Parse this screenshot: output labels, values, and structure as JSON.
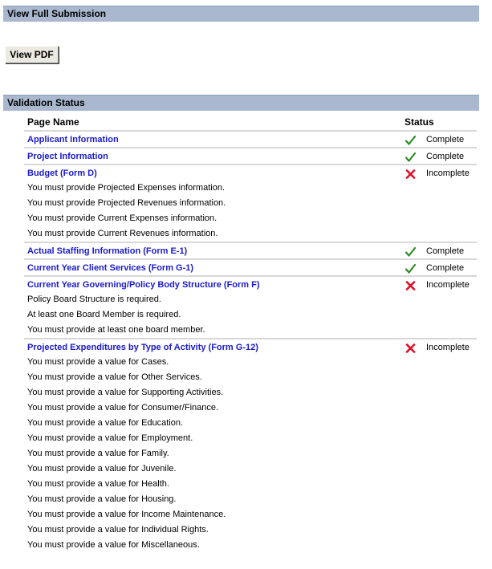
{
  "section1": {
    "title": "View Full Submission"
  },
  "pdf_button": {
    "label": "View PDF"
  },
  "section2": {
    "title": "Validation Status"
  },
  "table": {
    "col_page": "Page Name",
    "col_status": "Status",
    "entries": [
      {
        "name": "Applicant Information",
        "status": "Complete",
        "ok": true,
        "messages": []
      },
      {
        "name": "Project Information",
        "status": "Complete",
        "ok": true,
        "messages": []
      },
      {
        "name": "Budget (Form D)",
        "status": "Incomplete",
        "ok": false,
        "messages": [
          "You must provide Projected Expenses information.",
          "You must provide Projected Revenues information.",
          "You must provide Current Expenses information.",
          "You must provide Current Revenues information."
        ]
      },
      {
        "name": "Actual Staffing Information (Form E-1)",
        "status": "Complete",
        "ok": true,
        "messages": []
      },
      {
        "name": "Current Year Client Services (Form G-1)",
        "status": "Complete",
        "ok": true,
        "messages": []
      },
      {
        "name": "Current Year Governing/Policy Body Structure (Form F)",
        "status": "Incomplete",
        "ok": false,
        "messages": [
          "Policy Board Structure is required.",
          "At least one Board Member is required.",
          "You must provide at least one board member."
        ]
      },
      {
        "name": "Projected Expenditures by Type of Activity (Form G-12)",
        "status": "Incomplete",
        "ok": false,
        "messages": [
          "You must provide a value for Cases.",
          "You must provide a value for Other Services.",
          "You must provide a value for Supporting Activities.",
          "You must provide a value for Consumer/Finance.",
          "You must provide a value for Education.",
          "You must provide a value for Employment.",
          "You must provide a value for Family.",
          "You must provide a value for Juvenile.",
          "You must provide a value for Health.",
          "You must provide a value for Housing.",
          "You must provide a value for Income Maintenance.",
          "You must provide a value for Individual Rights.",
          "You must provide a value for Miscellaneous."
        ]
      }
    ]
  },
  "colors": {
    "link": "#1a1acc",
    "complete": "#2e8b22",
    "incomplete": "#e0102a",
    "bar": "#a9b8cf"
  },
  "icons": {
    "complete": "check-icon",
    "incomplete": "x-icon"
  }
}
